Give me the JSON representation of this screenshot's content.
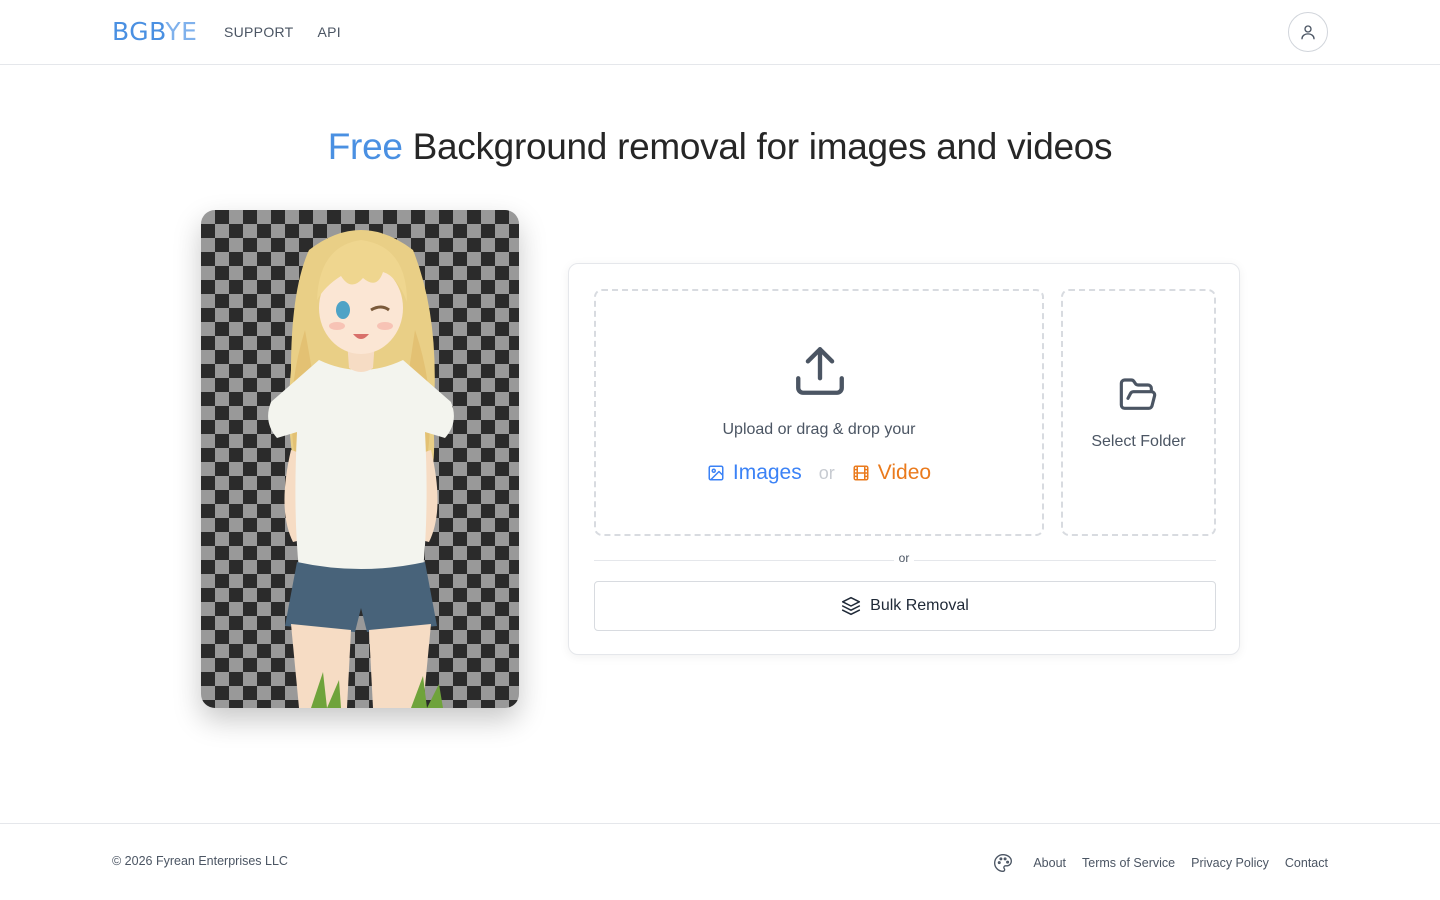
{
  "header": {
    "logo_part1": "BGB",
    "logo_part2": "YE",
    "nav": [
      "SUPPORT",
      "API"
    ],
    "user_icon": "user-icon"
  },
  "hero": {
    "headline_highlight": "Free",
    "headline_rest": " Background removal for images and videos"
  },
  "upload": {
    "prompt": "Upload or drag & drop your",
    "images_label": "Images",
    "or_label": "or",
    "video_label": "Video",
    "folder_label": "Select Folder",
    "divider_label": "or",
    "bulk_label": "Bulk Removal",
    "icons": [
      "upload-icon",
      "image-icon",
      "film-icon",
      "folder-open-icon",
      "layers-icon"
    ]
  },
  "footer": {
    "copyright": "© 2026 Fyrean Enterprises LLC",
    "links": [
      "About",
      "Terms of Service",
      "Privacy Policy",
      "Contact"
    ],
    "theme_icon": "palette-icon"
  },
  "colors": {
    "accent_blue": "#4a90e2",
    "accent_orange": "#ea7a1c"
  }
}
